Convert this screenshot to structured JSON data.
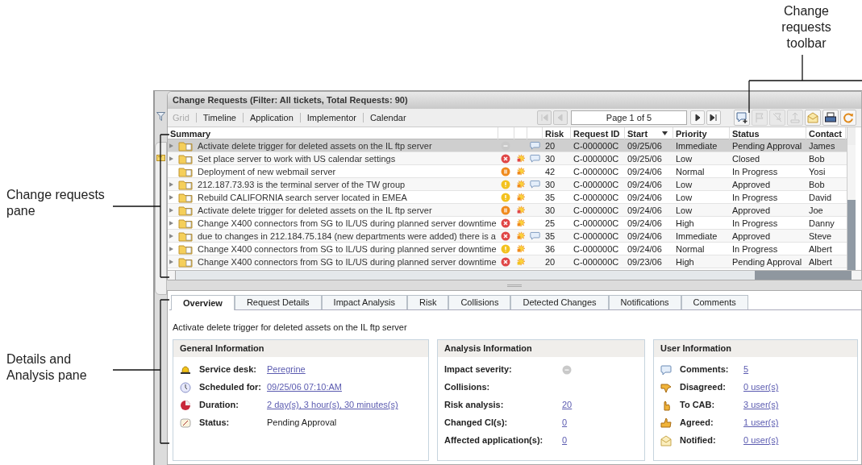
{
  "callouts": [
    {
      "kind": "toolbar",
      "text": "Change requests toolbar"
    },
    {
      "kind": "grid",
      "text": "Change requests pane"
    },
    {
      "kind": "details",
      "text": "Details and Analysis pane"
    }
  ],
  "requests": {
    "title": "Change Requests (Filter: All tickets, Total Requests: 90)",
    "views": [
      {
        "label": "Grid",
        "disabled": true
      },
      {
        "label": "Timeline",
        "disabled": false
      },
      {
        "label": "Application",
        "disabled": false
      },
      {
        "label": "Implementor",
        "disabled": false
      },
      {
        "label": "Calendar",
        "disabled": false
      }
    ],
    "pager": {
      "text": "Page 1 of 5",
      "buttons": [
        {
          "kind": "first",
          "disabled": true
        },
        {
          "kind": "prev",
          "disabled": true
        },
        {
          "kind": "next",
          "disabled": false
        },
        {
          "kind": "last",
          "disabled": false
        }
      ]
    },
    "toolbar": [
      {
        "kind": "add-comment",
        "disabled": false
      },
      {
        "kind": "flag",
        "disabled": true
      },
      {
        "kind": "unflag",
        "disabled": true
      },
      {
        "kind": "upload",
        "disabled": true
      },
      {
        "kind": "mail",
        "disabled": false
      },
      {
        "kind": "print",
        "disabled": false
      },
      {
        "kind": "refresh",
        "disabled": false
      }
    ],
    "columns": [
      {
        "label": "Summary",
        "sorted": false
      },
      {
        "label": "Risk",
        "sorted": false
      },
      {
        "label": "Request ID",
        "sorted": false
      },
      {
        "label": "Start",
        "sorted": true
      },
      {
        "label": "Priority",
        "sorted": false
      },
      {
        "label": "Status",
        "sorted": false
      },
      {
        "label": "Contact",
        "sorted": false
      }
    ],
    "rows": [
      {
        "selected": true,
        "expandable": true,
        "summary": "Activate delete trigger for deleted assets on the IL ftp server",
        "status_icon": {
          "kind": "none"
        },
        "comment": true,
        "risk": "20",
        "id": "C-000000C",
        "start": "09/25/06",
        "priority": "Immediate",
        "status": "Pending Approval",
        "contact": "James"
      },
      {
        "selected": false,
        "expandable": true,
        "summary": "Set place server to work with US calendar settings",
        "status_icon": {
          "kind": "critical"
        },
        "collision_icon": {
          "kind": "critical"
        },
        "comment": true,
        "risk": "30",
        "id": "C-000000C",
        "start": "09/25/06",
        "priority": "Low",
        "status": "Closed",
        "contact": "Bob"
      },
      {
        "selected": false,
        "expandable": false,
        "summary": "Deployment of new webmail server",
        "status_icon": {
          "kind": "major"
        },
        "collision_icon": {
          "kind": "major"
        },
        "comment": false,
        "risk": "42",
        "id": "C-000000C",
        "start": "09/24/06",
        "priority": "Normal",
        "status": "In Progress",
        "contact": "Yosi"
      },
      {
        "selected": false,
        "expandable": true,
        "summary": "212.187.73.93 is the terminal server of the TW group",
        "status_icon": {
          "kind": "minor"
        },
        "collision_icon": {
          "kind": "major"
        },
        "comment": true,
        "risk": "30",
        "id": "C-000000C",
        "start": "09/24/06",
        "priority": "Low",
        "status": "Approved",
        "contact": "Bob"
      },
      {
        "selected": false,
        "expandable": true,
        "summary": "Rebuild CALIFORNIA search server located in EMEA",
        "status_icon": {
          "kind": "minor"
        },
        "collision_icon": {
          "kind": "major"
        },
        "comment": false,
        "risk": "35",
        "id": "C-000000C",
        "start": "09/24/06",
        "priority": "Low",
        "status": "In Progress",
        "contact": "David"
      },
      {
        "selected": false,
        "expandable": true,
        "summary": "Activate delete trigger for deleted assets on the IL ftp server",
        "status_icon": {
          "kind": "major"
        },
        "collision_icon": {
          "kind": "critical"
        },
        "comment": false,
        "risk": "30",
        "id": "C-000000C",
        "start": "09/24/06",
        "priority": "Low",
        "status": "Approved",
        "contact": "Joe"
      },
      {
        "selected": false,
        "expandable": true,
        "summary": "Change X400 connectors from SG to IL/US during planned server downtime",
        "status_icon": {
          "kind": "critical"
        },
        "collision_icon": {
          "kind": "major"
        },
        "comment": false,
        "risk": "25",
        "id": "C-000000C",
        "start": "09/24/06",
        "priority": "High",
        "status": "In Progress",
        "contact": "Danny"
      },
      {
        "selected": false,
        "expandable": true,
        "summary": "due to changes in 212.184.75.184 (new departments were added) there is a",
        "status_icon": {
          "kind": "critical"
        },
        "collision_icon": {
          "kind": "major"
        },
        "comment": true,
        "risk": "35",
        "id": "C-000000C",
        "start": "09/24/06",
        "priority": "Immediate",
        "status": "Approved",
        "contact": "Steve"
      },
      {
        "selected": false,
        "expandable": true,
        "summary": "Change X400 connectors from SG to IL/US during planned server downtime",
        "status_icon": {
          "kind": "minor"
        },
        "collision_icon": {
          "kind": "major"
        },
        "comment": false,
        "risk": "36",
        "id": "C-000000C",
        "start": "09/24/06",
        "priority": "Normal",
        "status": "In Progress",
        "contact": "Albert"
      },
      {
        "selected": false,
        "expandable": true,
        "summary": "Change X400 connectors from SG to IL/US during planned server downtime",
        "status_icon": {
          "kind": "critical"
        },
        "collision_icon": {
          "kind": "minor"
        },
        "comment": false,
        "risk": "20",
        "id": "C-000000C",
        "start": "09/23/06",
        "priority": "High",
        "status": "Pending Approval",
        "contact": "Albert"
      }
    ]
  },
  "details": {
    "tabs": [
      {
        "label": "Overview",
        "selected": true
      },
      {
        "label": "Request Details",
        "selected": false
      },
      {
        "label": "Impact Analysis",
        "selected": false
      },
      {
        "label": "Risk",
        "selected": false
      },
      {
        "label": "Collisions",
        "selected": false
      },
      {
        "label": "Detected Changes",
        "selected": false
      },
      {
        "label": "Notifications",
        "selected": false
      },
      {
        "label": "Comments",
        "selected": false
      }
    ],
    "description": "Activate delete trigger for deleted assets on the IL ftp server",
    "panels": [
      {
        "title": "General Information",
        "items": [
          {
            "kind": "bell",
            "label": "Service desk:",
            "value": "Peregrine",
            "link": true
          },
          {
            "kind": "clock",
            "label": "Scheduled for:",
            "value": "09/25/06 07:10:AM",
            "link": true
          },
          {
            "kind": "ball",
            "label": "Duration:",
            "value": "2 day(s), 3 hour(s), 30 minutes(s)",
            "link": true
          },
          {
            "kind": "gauge",
            "label": "Status:",
            "value": "Pending Approval",
            "link": false
          }
        ]
      },
      {
        "title": "Analysis Information",
        "items": [
          {
            "label": "Impact severity:",
            "severity_icon": {
              "kind": "none"
            }
          },
          {
            "label": "Collisions:"
          },
          {
            "label": "Risk analysis:",
            "value": "20",
            "link": true
          },
          {
            "label": "Changed CI(s):",
            "value": "0",
            "link": true
          },
          {
            "label": "Affected application(s):",
            "value": "0",
            "link": true
          }
        ]
      },
      {
        "title": "User Information",
        "items": [
          {
            "kind": "comment",
            "label": "Comments:",
            "value": "5",
            "link": true
          },
          {
            "kind": "thumb-down",
            "label": "Disagreed:",
            "value": "0 user(s)",
            "link": true
          },
          {
            "kind": "hand",
            "label": "To CAB:",
            "value": "3 user(s)",
            "link": true
          },
          {
            "kind": "thumb-up",
            "label": "Agreed:",
            "value": "1 user(s)",
            "link": true
          },
          {
            "kind": "envelope",
            "label": "Notified:",
            "value": "0 user(s)",
            "link": true
          }
        ]
      }
    ]
  }
}
